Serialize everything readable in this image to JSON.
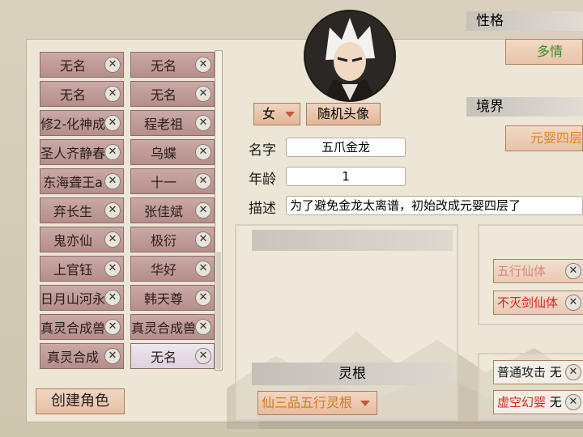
{
  "characters": [
    {
      "name": "无名"
    },
    {
      "name": "无名"
    },
    {
      "name": "无名"
    },
    {
      "name": "无名"
    },
    {
      "name": "修2-化神成"
    },
    {
      "name": "程老祖"
    },
    {
      "name": "圣人齐静春"
    },
    {
      "name": "乌蝶"
    },
    {
      "name": "东海聋王a"
    },
    {
      "name": "十一"
    },
    {
      "name": "弃长生"
    },
    {
      "name": "张佳斌"
    },
    {
      "name": "鬼亦仙"
    },
    {
      "name": "极衍"
    },
    {
      "name": "上官钰"
    },
    {
      "name": "华好"
    },
    {
      "name": "日月山河永"
    },
    {
      "name": "韩天尊"
    },
    {
      "name": "真灵合成兽"
    },
    {
      "name": "真灵合成兽"
    },
    {
      "name": "真灵合成"
    },
    {
      "name": "无名"
    }
  ],
  "delete_symbol": "✕",
  "create_button": "创建角色",
  "gender": "女",
  "random_avatar": "随机头像",
  "labels": {
    "name": "名字",
    "age": "年龄",
    "desc": "描述"
  },
  "name_value": "五爪金龙",
  "age_value": "1",
  "desc_value": "为了避免金龙太离谱，初始改成元婴四层了",
  "spirit_root": {
    "header": "灵根",
    "value": "仙三品五行灵根"
  },
  "personality": {
    "header": "性格",
    "value": "多情"
  },
  "realm": {
    "header": "境界",
    "value": "元婴四层"
  },
  "traits": [
    {
      "name": "五行仙体",
      "color": "#c9573f"
    },
    {
      "name": "不灭剑仙体",
      "color": "#d7261f"
    }
  ],
  "skills": [
    {
      "name": "普通攻击",
      "suffix": "无",
      "color": "#1c1c1c"
    },
    {
      "name": "虚空幻婴",
      "suffix": "无",
      "color": "#d7261f"
    }
  ]
}
